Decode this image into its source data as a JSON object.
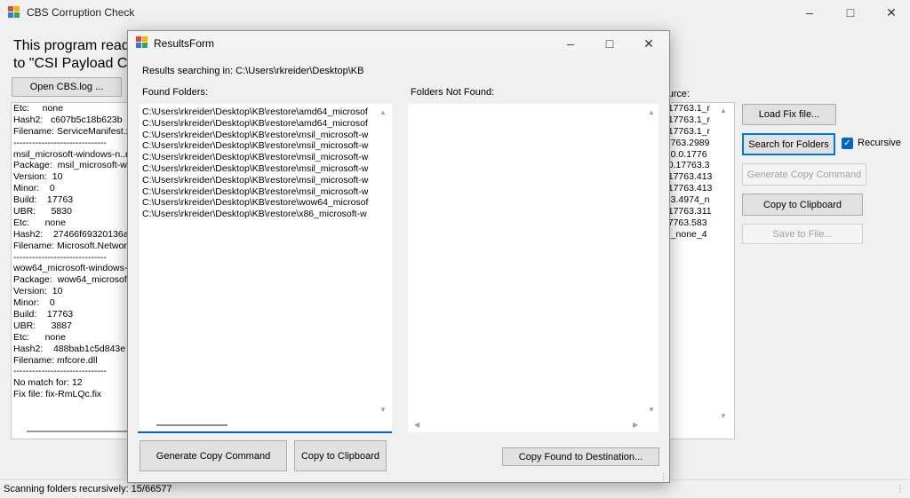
{
  "main_window": {
    "title": "CBS Corruption Check",
    "intro_line1": "This program read",
    "intro_line2": "to \"CSI Payload Co",
    "open_cbs_label": "Open CBS.log ...",
    "source_label": "source:",
    "load_fix_label": "Load Fix file...",
    "search_folders_label": "Search for Folders",
    "recursive_label": "Recursive",
    "recursive_checked": true,
    "generate_copy_label": "Generate Copy Command",
    "copy_clipboard_label": "Copy to Clipboard",
    "save_to_file_label": "Save to File...",
    "log_lines": [
      "Etc:     none",
      "Hash2:   c607b5c18b623b",
      "Filename: ServiceManifest.x",
      "------------------------------",
      "msil_microsoft-windows-n..rk",
      "Package:  msil_microsoft-wi",
      "Version:  10",
      "Minor:    0",
      "Build:    17763",
      "UBR:      5830",
      "Etc:      none",
      "Hash2:    27466f69320136a",
      "Filename: Microsoft.Network",
      "------------------------------",
      "wow64_microsoft-windows-",
      "Package:  wow64_microsof",
      "Version:  10",
      "Minor:    0",
      "Build:    17763",
      "UBR:      3887",
      "Etc:      none",
      "Hash2:    488bab1c5d843e",
      "Filename: mfcore.dll",
      "------------------------------",
      "No match for: 12",
      "Fix file: fix-RmLQc.fix"
    ],
    "right_lines": [
      "0.17763.1_r",
      "0.17763.1_r",
      "0.17763.1_r",
      "17763.2989",
      "_10.0.1776",
      "0.0.17763.3",
      "0.17763.413",
      "0.17763.413",
      "763.4974_n",
      "0.17763.311",
      ".17763.583",
      "87_none_4"
    ],
    "status_text": "Scanning folders recursively: 15/66577"
  },
  "results_form": {
    "title": "ResultsForm",
    "searching_label": "Results searching in: C:\\Users\\rkreider\\Desktop\\KB",
    "found_label": "Found Folders:",
    "not_found_label": "Folders Not Found:",
    "found_folders": [
      "C:\\Users\\rkreider\\Desktop\\KB\\restore\\amd64_microsof",
      "C:\\Users\\rkreider\\Desktop\\KB\\restore\\amd64_microsof",
      "C:\\Users\\rkreider\\Desktop\\KB\\restore\\msil_microsoft-w",
      "C:\\Users\\rkreider\\Desktop\\KB\\restore\\msil_microsoft-w",
      "C:\\Users\\rkreider\\Desktop\\KB\\restore\\msil_microsoft-w",
      "C:\\Users\\rkreider\\Desktop\\KB\\restore\\msil_microsoft-w",
      "C:\\Users\\rkreider\\Desktop\\KB\\restore\\msil_microsoft-w",
      "C:\\Users\\rkreider\\Desktop\\KB\\restore\\msil_microsoft-w",
      "C:\\Users\\rkreider\\Desktop\\KB\\restore\\wow64_microsof",
      "C:\\Users\\rkreider\\Desktop\\KB\\restore\\x86_microsoft-w"
    ],
    "generate_label": "Generate Copy Command",
    "clipboard_label": "Copy to Clipboard",
    "copy_dest_label": "Copy Found to Destination..."
  },
  "icons": {
    "minimize": "minimize-icon",
    "maximize": "maximize-icon",
    "close": "close-icon",
    "app": "app-icon",
    "checkmark": "checkmark-icon"
  }
}
